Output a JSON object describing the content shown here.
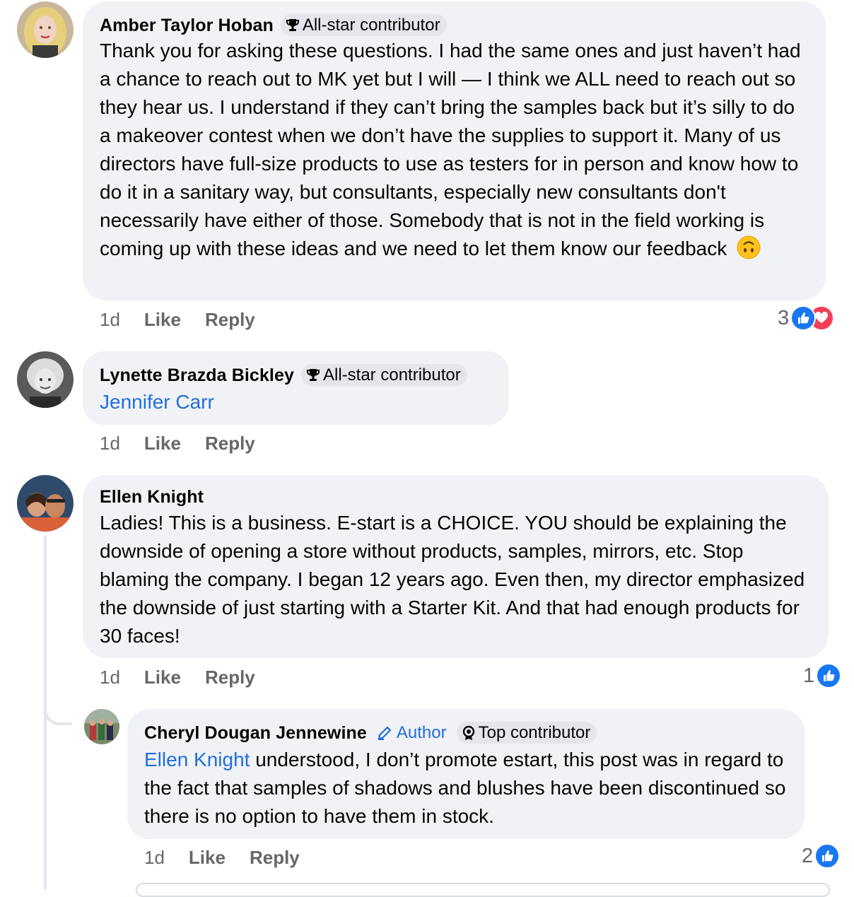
{
  "comments": [
    {
      "author": "Amber Taylor Hoban",
      "badge": "All-star contributor",
      "text": "Thank you for asking these questions. I had the same ones and just haven’t had a chance to reach out to MK yet but I will — I think we ALL need to reach out so they hear us.  I understand if they can’t bring the samples back but it’s silly to do a makeover contest when we don’t have the supplies to support it.  Many of us directors have full-size products to use as testers for in person and know how to do it in a sanitary way, but consultants, especially new consultants don't necessarily have either of those. Somebody that is not in the field working is coming up with these ideas and we need to let them know our feedback",
      "time": "1d",
      "like": "Like",
      "reply": "Reply",
      "reaction_count": "3",
      "reactions": [
        "like-icon",
        "love-icon"
      ]
    },
    {
      "author": "Lynette Brazda Bickley",
      "badge": "All-star contributor",
      "mention": "Jennifer Carr",
      "time": "1d",
      "like": "Like",
      "reply": "Reply"
    },
    {
      "author": "Ellen Knight",
      "text": "Ladies! This is a business.  E-start is a CHOICE. YOU should be explaining the downside of opening a store without products, samples, mirrors, etc. Stop blaming the company. I began 12 years ago. Even then, my director emphasized the downside of just starting with a Starter Kit. And that had enough products for 30 faces!",
      "time": "1d",
      "like": "Like",
      "reply": "Reply",
      "reaction_count": "1",
      "reactions": [
        "like-icon"
      ]
    },
    {
      "author": "Cheryl Dougan Jennewine",
      "author_tag": "Author",
      "badge": "Top contributor",
      "mention": "Ellen Knight",
      "text": " understood, I don’t  promote estart, this post was in regard to the fact that samples of shadows and blushes have been discontinued so there is no option to have them in stock.",
      "time": "1d",
      "like": "Like",
      "reply": "Reply",
      "reaction_count": "2",
      "reactions": [
        "like-icon"
      ]
    }
  ],
  "colors": {
    "bubble": "#f0f2f5",
    "mention": "#216fdb",
    "muted": "#65676b",
    "like": "#1877f2",
    "love": "#f33e58"
  }
}
